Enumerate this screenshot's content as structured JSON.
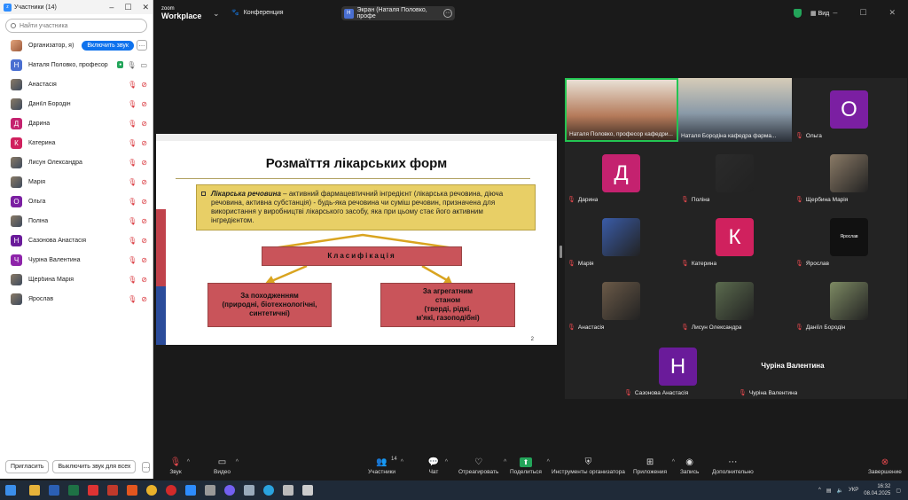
{
  "panel": {
    "title": "Участники (14)",
    "search_placeholder": "Найти участника",
    "host": {
      "name": "Организатор, я)",
      "unmute_label": "Включить звук",
      "more": "…"
    },
    "presenter": {
      "avatar": "Н",
      "name": "Наталя Половко, професор",
      "badge": "●",
      "color": "#4a6fd1"
    },
    "participants": [
      {
        "avatar": "",
        "name": "Анастасія",
        "color": "#6b5a48",
        "photo": true
      },
      {
        "avatar": "",
        "name": "Даніїл Бородін",
        "color": "#7d8a63",
        "photo": true
      },
      {
        "avatar": "Д",
        "name": "Дарина",
        "color": "#c4226f"
      },
      {
        "avatar": "К",
        "name": "Катерина",
        "color": "#d0215e"
      },
      {
        "avatar": "",
        "name": "Лисун Олександра",
        "color": "#5b6b4e",
        "photo": true
      },
      {
        "avatar": "",
        "name": "Марія",
        "color": "#3a5ca8",
        "photo": true
      },
      {
        "avatar": "О",
        "name": "Ольга",
        "color": "#7b1fa2"
      },
      {
        "avatar": "",
        "name": "Поліна",
        "color": "#2b2b2b",
        "photo": true
      },
      {
        "avatar": "Н",
        "name": "Сазонова Анастасія",
        "color": "#6a1b9a"
      },
      {
        "avatar": "Ч",
        "name": "Чуріна Валентина",
        "color": "#8e24aa"
      },
      {
        "avatar": "",
        "name": "Щербина Марія",
        "color": "#8a7a66",
        "photo": true
      },
      {
        "avatar": "",
        "name": "Ярослав",
        "color": "#111111",
        "photo": true
      }
    ],
    "invite_label": "Пригласить",
    "mute_all_label": "Выключить звук для всех",
    "footer_more": "…"
  },
  "topbar": {
    "logo_top": "zoom",
    "logo_bottom": "Workplace",
    "conference_label": "Конференция",
    "screen_avatar": "Н",
    "screen_label": "Экран (Наталя Половко, профе",
    "view_label": "Вид"
  },
  "slide": {
    "title": "Розмаїття лікарських форм",
    "def_term": "Лікарська речовина",
    "def_text": " – активний фармацевтичний інгредієнт (лікарська речовина, діюча речовина, активна субстанція) - будь-яка речовина чи суміш речовин, призначена для використання у виробництві лікарського засобу, яка при цьому стає його активним інгредієнтом.",
    "class_label": "Класифікація",
    "sub1_lines": [
      "За походженням",
      "(природні, біотехнологічні,",
      "синтетичні)"
    ],
    "sub2_lines": [
      "За агрегатним",
      "станом",
      "(тверді, рідкі,",
      "м'які, газоподібні)"
    ],
    "page_number": "2"
  },
  "gallery": {
    "tiles": [
      {
        "name": "Наталя Половко, професор кафедри...",
        "kind": "cam",
        "muted": false
      },
      {
        "name": "Наталя Бородіна кафедра фарма...",
        "kind": "cam",
        "muted": false
      },
      {
        "name": "Ольга",
        "avatar": "О",
        "color": "#7b1fa2",
        "muted": true
      },
      {
        "name": "Дарина",
        "avatar": "Д",
        "color": "#c4226f",
        "muted": true
      },
      {
        "name": "Поліна",
        "avatar": "",
        "color": "#2b2b2b",
        "muted": true
      },
      {
        "name": "Щербина Марія",
        "avatar": "",
        "color": "#8a7a66",
        "muted": true
      },
      {
        "name": "Марія",
        "avatar": "",
        "color": "#3a5ca8",
        "muted": true
      },
      {
        "name": "Катерина",
        "avatar": "К",
        "color": "#d0215e",
        "muted": true
      },
      {
        "name": "Ярослав",
        "avatar": "Ярослав",
        "color": "#111111",
        "muted": true
      },
      {
        "name": "Анастасія",
        "avatar": "",
        "color": "#6b5a48",
        "muted": true
      },
      {
        "name": "Лисун Олександра",
        "avatar": "",
        "color": "#5b6b4e",
        "muted": true
      },
      {
        "name": "Даніїл Бородін",
        "avatar": "",
        "color": "#7d8a63",
        "muted": true
      },
      {
        "name": "Сазонова Анастасія",
        "avatar": "Н",
        "color": "#6a1b9a",
        "muted": true
      },
      {
        "name": "Чуріна Валентина",
        "avatar": "",
        "color": "#232323",
        "muted": true,
        "bigname": "Чуріна Валентина"
      }
    ]
  },
  "toolbar": {
    "audio": "Звук",
    "video": "Видео",
    "participants": "Участники",
    "participants_count": "14",
    "chat": "Чат",
    "react": "Отреагировать",
    "share": "Поделиться",
    "host_tools": "Инструменты организатора",
    "apps": "Приложения",
    "record": "Запись",
    "more": "Дополнительно",
    "end": "Завершение"
  },
  "taskbar": {
    "lang": "УКР",
    "time": "16:32",
    "date": "08.04.2025"
  }
}
